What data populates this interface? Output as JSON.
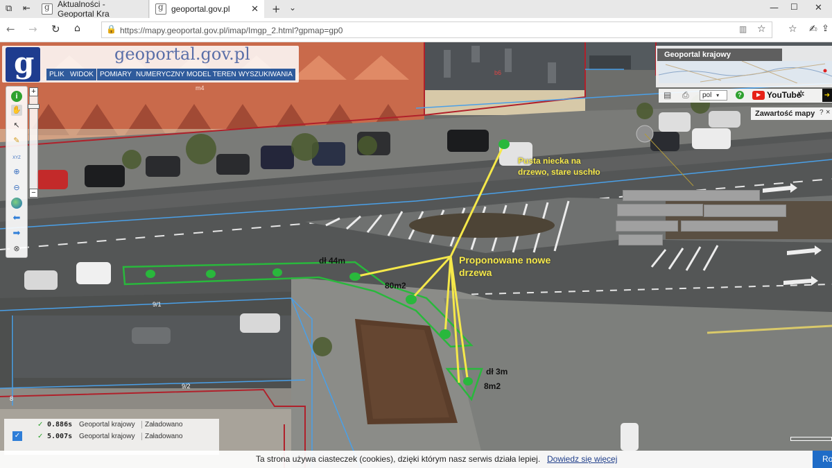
{
  "browser": {
    "tabs": [
      {
        "label": "Aktualności - Geoportal Kra"
      },
      {
        "label": "geoportal.gov.pl"
      }
    ],
    "url": "https://mapy.geoportal.gov.pl/imap/Imgp_2.html?gpmap=gp0"
  },
  "geoportal": {
    "brand": "geoportal.gov.pl",
    "menu": [
      "PLIK",
      "WIDOK",
      "POMIARY",
      "NUMERYCZNY MODEL TERENU",
      "WYSZUKIWANIA"
    ],
    "minimap_title": "Geoportal krajowy",
    "language": "pol",
    "youtube": "YouTube",
    "content_button": "Zawartość mapy",
    "help": "?",
    "close": "×"
  },
  "map_labels": {
    "m4": "m4",
    "b6": "b6",
    "p91": "9/1",
    "p92": "9/2",
    "p8": "8"
  },
  "annotations": {
    "pusta": [
      "Pusta niecka na",
      "drzewo, stare uschło"
    ],
    "proponowane": [
      "Proponowane nowe",
      "drzewa"
    ],
    "dl44": "dł 44m",
    "m80": "80m2",
    "dl3": "dł 3m",
    "m8": "8m2"
  },
  "status": [
    {
      "time": "0.886s",
      "name": "Geoportal krajowy",
      "state": "Załadowano"
    },
    {
      "time": "5.007s",
      "name": "Geoportal krajowy",
      "state": "Załadowano"
    }
  ],
  "cookie": {
    "text": "Ta strona używa ciasteczek (cookies), dzięki którym nasz serwis działa lepiej.",
    "link": "Dowiedz się więcej",
    "accept": "Rozumiem"
  },
  "colors": {
    "annotation_yellow": "#f5e84a",
    "annotation_green": "#29b83c",
    "parcel_red": "#b0202a",
    "parcel_blue": "#4aa0e8",
    "brand_blue": "#1e3c8f"
  }
}
